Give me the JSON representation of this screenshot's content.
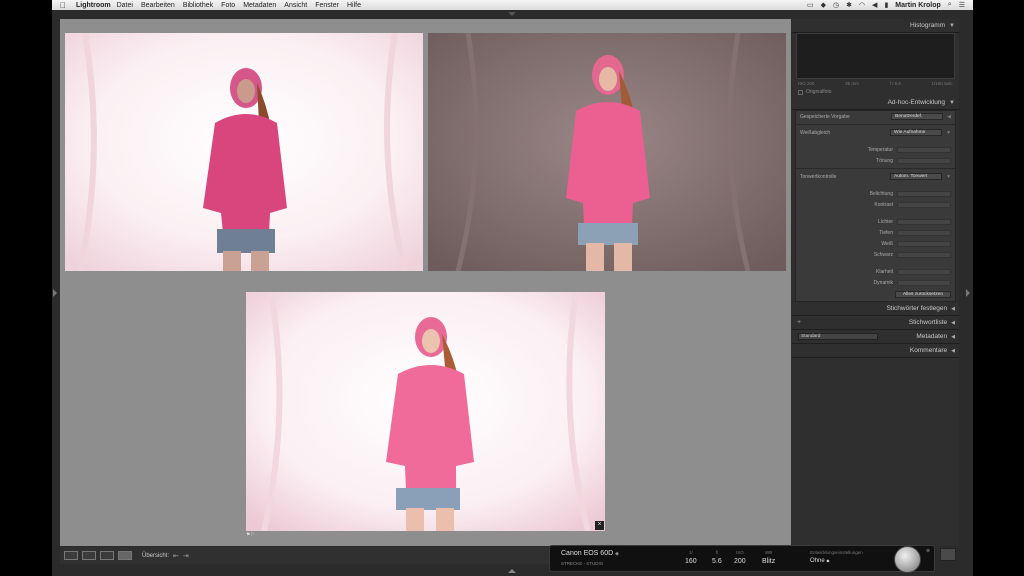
{
  "menubar": {
    "app": "Lightroom",
    "items": [
      "Datei",
      "Bearbeiten",
      "Bibliothek",
      "Foto",
      "Metadaten",
      "Ansicht",
      "Fenster",
      "Hilfe"
    ],
    "user": "Martin Krolop"
  },
  "panel": {
    "histogram": "Histogramm",
    "histo_info": [
      "ISO 200",
      "35 mm",
      "f / 5,6",
      "1/160 Sek."
    ],
    "original": "Originalfoto",
    "adhoc": "Ad-hoc-Entwicklung",
    "preset_label": "Gespeicherte Vorgabe",
    "preset_value": "Benutzerdef.",
    "wb_label": "Weißabgleich",
    "wb_value": "Wie Aufnahme",
    "temperature": "Temperatur",
    "tint": "Tönung",
    "tone_label": "Tonwertkontrolle",
    "auto_tone": "Autom. Tonwert",
    "exposure": "Belichtung",
    "contrast": "Kontrast",
    "highlights": "Lichter",
    "shadows": "Tiefen",
    "whites": "Weiß",
    "blacks": "Schwarz",
    "clarity": "Klarheit",
    "vibrance": "Dynamik",
    "reset": "Alles zurücksetzen",
    "keywording": "Stichwörter festlegen",
    "keyword_list": "Stichwortliste",
    "meta_select": "Standard",
    "metadata": "Metadaten",
    "comments": "Kommentare"
  },
  "toolbar": {
    "overview": "Übersicht:"
  },
  "camera": {
    "name": "Canon EOS 60D",
    "sub": "STRECKE - STUDIO",
    "cols": [
      {
        "h": "1/",
        "v": "160"
      },
      {
        "h": "f/",
        "v": "5.6"
      },
      {
        "h": "ISO",
        "v": "200"
      },
      {
        "h": "WB",
        "v": "Blitz"
      }
    ],
    "settings_label": "Entwicklungseinstellungen",
    "settings_value": "Ohne"
  }
}
